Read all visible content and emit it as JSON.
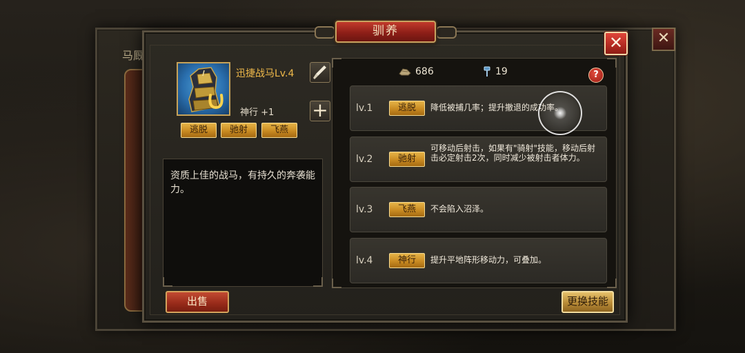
{
  "background": {
    "back_dialog_title": "马厩"
  },
  "dialog": {
    "title": "驯养",
    "close_symbol": "✕"
  },
  "horse": {
    "name": "迅捷战马Lv.4",
    "stat": "神行 +1",
    "tags": [
      "逃脱",
      "驰射",
      "飞燕"
    ],
    "description": "资质上佳的战马，有持久的奔袭能力。",
    "add_symbol": "+"
  },
  "resources": [
    {
      "icon": "hay-icon",
      "value": "686"
    },
    {
      "icon": "horseshoe-nail-icon",
      "value": "19"
    }
  ],
  "help_symbol": "?",
  "skills": [
    {
      "level": "lv.1",
      "tag": "逃脱",
      "desc": "降低被捕几率；提升撤退的成功率。"
    },
    {
      "level": "lv.2",
      "tag": "驰射",
      "desc": "可移动后射击，如果有\"骑射\"技能，移动后射击必定射击2次，同时减少被射击者体力。"
    },
    {
      "level": "lv.3",
      "tag": "飞燕",
      "desc": "不会陷入沼泽。"
    },
    {
      "level": "lv.4",
      "tag": "神行",
      "desc": "提升平地阵形移动力，可叠加。"
    }
  ],
  "buttons": {
    "sell": "出售",
    "change_skill": "更换技能"
  },
  "colors": {
    "accent_gold": "#e5b347",
    "title_red": "#c23a2c",
    "name_orange": "#f0b94a"
  }
}
